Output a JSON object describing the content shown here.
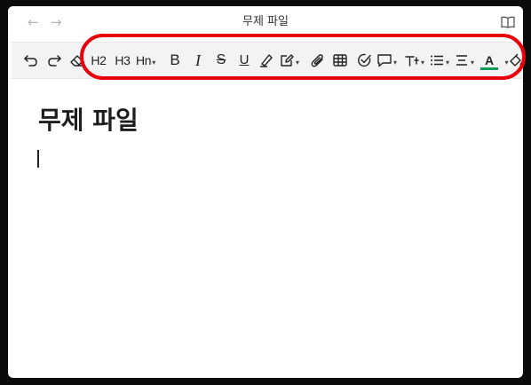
{
  "window": {
    "title": "무제 파일",
    "back_glyph": "←",
    "forward_glyph": "→"
  },
  "toolbar": {
    "items": [
      {
        "name": "undo-icon"
      },
      {
        "name": "redo-icon"
      },
      {
        "name": "eraser-icon"
      },
      {
        "label": "H2"
      },
      {
        "label": "H3"
      },
      {
        "label": "Hn"
      },
      {
        "label": "B"
      },
      {
        "label": "I"
      },
      {
        "label": "S"
      },
      {
        "label": "U"
      },
      {
        "name": "highlighter-icon"
      },
      {
        "name": "edit-box-icon"
      },
      {
        "name": "paperclip-icon"
      },
      {
        "name": "table-icon"
      },
      {
        "name": "checkbox-circle-icon"
      },
      {
        "name": "comment-icon"
      },
      {
        "name": "text-format-icon"
      },
      {
        "name": "list-icon"
      },
      {
        "name": "align-icon"
      },
      {
        "label": "A"
      },
      {
        "name": "fill-icon"
      }
    ],
    "caret_glyph": "▾",
    "font_color": "#0f9d58",
    "annotation_color": "#e8000a"
  },
  "editor": {
    "heading": "무제 파일"
  }
}
